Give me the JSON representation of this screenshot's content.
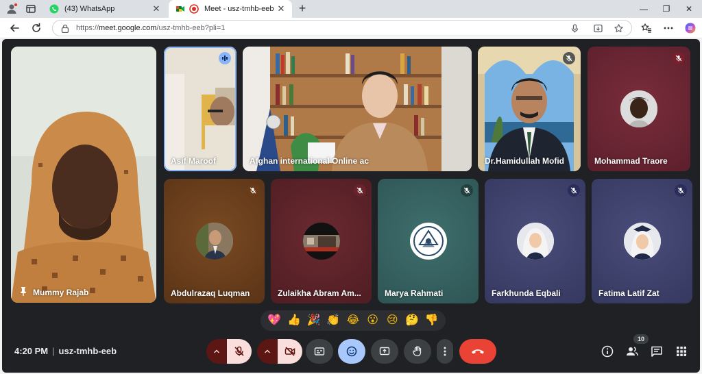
{
  "browser": {
    "tabs": [
      {
        "title": "(43) WhatsApp",
        "state": "inactive"
      },
      {
        "title": "Meet - usz-tmhb-eeb",
        "state": "active"
      }
    ],
    "url_prefix": "https://",
    "url_host": "meet.google.com",
    "url_path": "/usz-tmhb-eeb?pli=1"
  },
  "meet": {
    "pinned": {
      "name": "Mummy Rajab"
    },
    "participants": [
      {
        "name": "Asif Maroof",
        "status": "speaking"
      },
      {
        "name": "Afghan international Online ac",
        "status": "video"
      },
      {
        "name": "Dr.Hamidullah Mofid",
        "status": "muted"
      },
      {
        "name": "Mohammad Traore",
        "status": "muted"
      },
      {
        "name": "Abdulrazaq Luqman",
        "status": "muted"
      },
      {
        "name": "Zulaikha Abram Am...",
        "status": "muted"
      },
      {
        "name": "Marya Rahmati",
        "status": "muted"
      },
      {
        "name": "Farkhunda Eqbali",
        "status": "muted"
      },
      {
        "name": "Fatima Latif Zat",
        "status": "muted"
      }
    ],
    "reactions": [
      "💖",
      "👍",
      "🎉",
      "👏",
      "😂",
      "😮",
      "😢",
      "🤔",
      "👎"
    ],
    "time": "4:20 PM",
    "separator": "|",
    "meeting_code": "usz-tmhb-eeb",
    "people_count": "10",
    "colors": {
      "danger": "#ea4335",
      "mic_off_bg": "#f9dedc",
      "reaction_active": "#a8c7fa",
      "control_bg": "#3c4043"
    }
  }
}
